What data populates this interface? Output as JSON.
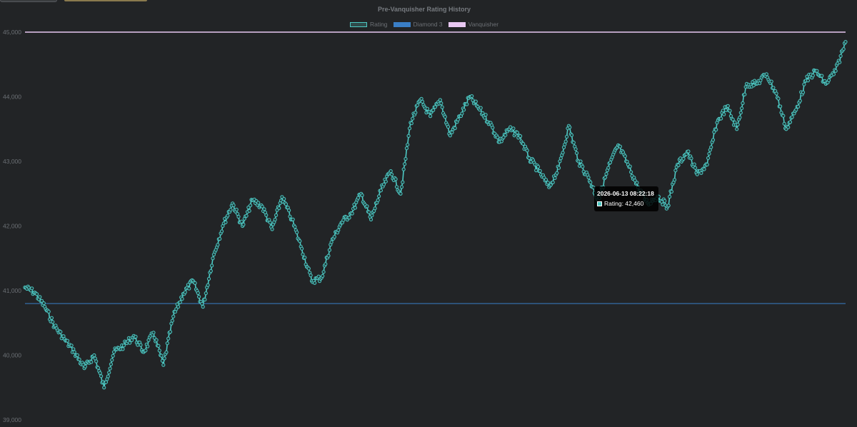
{
  "chart_data": {
    "type": "line",
    "title": "Pre-Vanquisher Rating History",
    "ylim": [
      39000,
      45000
    ],
    "yticks": [
      "39,000",
      "40,000",
      "41,000",
      "42,000",
      "43,000",
      "44,000",
      "45,000"
    ],
    "grid": false,
    "legend_position": "top",
    "series": [
      {
        "name": "Rating",
        "color": "#4ec9c4",
        "values": [
          41050,
          40970,
          40750,
          40450,
          40250,
          40050,
          39800,
          40000,
          39500,
          40050,
          40150,
          40300,
          40050,
          40350,
          39850,
          40600,
          40950,
          41150,
          40750,
          41500,
          42000,
          42350,
          42000,
          42400,
          42300,
          41950,
          42450,
          42100,
          41650,
          41150,
          41200,
          41750,
          42050,
          42200,
          42500,
          42100,
          42550,
          42850,
          42500,
          43600,
          43950,
          43700,
          43950,
          43400,
          43700,
          44000,
          43800,
          43600,
          43300,
          43500,
          43400,
          43050,
          42850,
          42600,
          42900,
          43550,
          43000,
          42750,
          42400,
          42900,
          43250,
          42950,
          42600,
          42350,
          42460,
          42300,
          42950,
          43150,
          42800,
          42950,
          43600,
          43850,
          43500,
          44200,
          44200,
          44350,
          44050,
          43500,
          43800,
          44250,
          44400,
          44200,
          44400,
          44850
        ]
      },
      {
        "name": "Diamond 3",
        "color": "#3a7ec6",
        "value": 40800
      },
      {
        "name": "Vanquisher",
        "color": "#e8c8f2",
        "value": 45000
      }
    ],
    "tooltip": {
      "title": "2026-06-13 08:22:18",
      "label": "Rating: 42,460"
    }
  }
}
